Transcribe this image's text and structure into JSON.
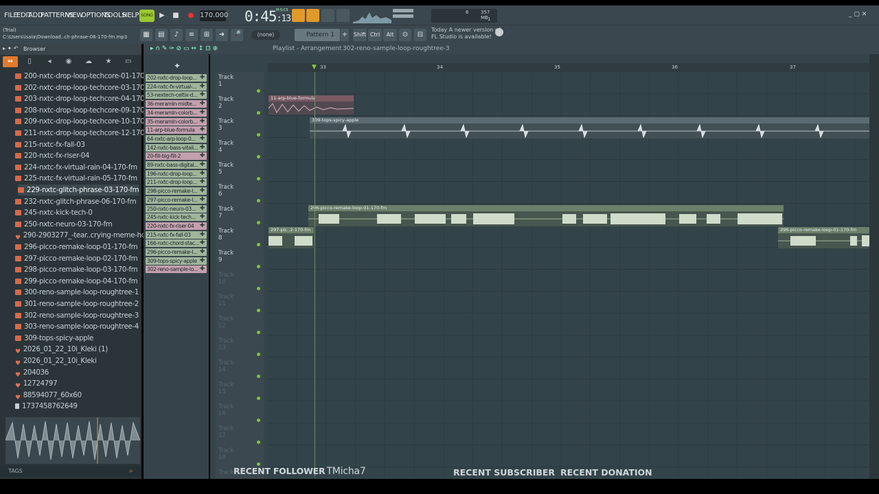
{
  "menu": [
    "FILE",
    "EDIT",
    "ADD",
    "PATTERNS",
    "VIEW",
    "OPTIONS",
    "TOOLS",
    "HELP"
  ],
  "transport": {
    "mode": "SONG",
    "tempo": "170.000",
    "time": "0:45",
    "time_frac": ":13",
    "time_unit": "M:S:CS",
    "cpu": "6",
    "mem": "357 MB",
    "poly": "1"
  },
  "title": {
    "trial": "(Trial)",
    "path": "C:\\Users\\isaia\\Download..ch-phrase-06-170-fm.mp3"
  },
  "toolbar2": {
    "none_label": "(none)",
    "pattern": "Pattern 1",
    "shift": "Shift",
    "ctrl": "Ctrl",
    "alt": "Alt"
  },
  "hint": {
    "line1": "Today  A newer version of",
    "line2": "FL Studio is available!"
  },
  "browser": {
    "title": "Browser",
    "tags": "TAGS",
    "items": [
      {
        "label": "200-nxtc-drop-loop-techcore-01-170-fm",
        "type": "audio"
      },
      {
        "label": "202-nxtc-drop-loop-techcore-03-170-fm",
        "type": "audio"
      },
      {
        "label": "203-nxtc-drop-loop-techcore-04-170-fm",
        "type": "audio"
      },
      {
        "label": "208-nxtc-drop-loop-techcore-09-170-fm",
        "type": "audio"
      },
      {
        "label": "209-nxtc-drop-loop-techcore-10-170-fm",
        "type": "audio"
      },
      {
        "label": "211-nxtc-drop-loop-techcore-12-170-fm",
        "type": "audio"
      },
      {
        "label": "215-nxtc-fx-fall-03",
        "type": "audio"
      },
      {
        "label": "220-nxtc-fx-riser-04",
        "type": "audio"
      },
      {
        "label": "224-nxtc-fx-virtual-rain-04-170-fm",
        "type": "audio"
      },
      {
        "label": "225-nxtc-fx-virtual-rain-05-170-fm",
        "type": "audio"
      },
      {
        "label": "229-nxtc-glitch-phrase-03-170-fm",
        "type": "audio"
      },
      {
        "label": "232-nxtc-glitch-phrase-06-170-fm",
        "type": "audio"
      },
      {
        "label": "245-nxtc-kick-tech-0",
        "type": "audio"
      },
      {
        "label": "250-nxtc-neuro-03-170-fm",
        "type": "audio"
      },
      {
        "label": "290-2903277_-tear..crying-meme-hd-png",
        "type": "image"
      },
      {
        "label": "296-picco-remake-loop-01-170-fm",
        "type": "audio"
      },
      {
        "label": "297-picco-remake-loop-02-170-fm",
        "type": "audio"
      },
      {
        "label": "298-picco-remake-loop-03-170-fm",
        "type": "audio"
      },
      {
        "label": "299-picco-remake-loop-04-170-fm",
        "type": "audio"
      },
      {
        "label": "300-reno-sample-loop-roughtree-1",
        "type": "audio"
      },
      {
        "label": "301-reno-sample-loop-roughtree-2",
        "type": "audio"
      },
      {
        "label": "302-reno-sample-loop-roughtree-3",
        "type": "audio"
      },
      {
        "label": "303-reno-sample-loop-roughtree-4",
        "type": "audio"
      },
      {
        "label": "309-tops-spicy-apple",
        "type": "audio"
      },
      {
        "label": "2026_01_22_10i_Kleki (1)",
        "type": "image"
      },
      {
        "label": "2026_01_22_10i_Kleki",
        "type": "image"
      },
      {
        "label": "204036",
        "type": "image"
      },
      {
        "label": "12724797",
        "type": "image"
      },
      {
        "label": "88594077_60x60",
        "type": "image"
      },
      {
        "label": "1737458762649",
        "type": "file"
      }
    ]
  },
  "picker": [
    {
      "label": "202-nxtc-drop-loop...",
      "color": "green"
    },
    {
      "label": "224-nxtc-fx-virtual-...",
      "color": "green"
    },
    {
      "label": "53-nextech-celtix-d...",
      "color": "green"
    },
    {
      "label": "36-meramIn-midte...",
      "color": "pink"
    },
    {
      "label": "34-meramIn-colorb...",
      "color": "pink"
    },
    {
      "label": "35-meramIn-colorb...",
      "color": "pink"
    },
    {
      "label": "11-arp-blue-formula",
      "color": "pink"
    },
    {
      "label": "64-nxtc-arp-loop-0...",
      "color": "green"
    },
    {
      "label": "142-nxtc-bass-vitali...",
      "color": "green"
    },
    {
      "label": "20-fill-big-fill-2",
      "color": "pink"
    },
    {
      "label": "89-nxtc-bass-digital...",
      "color": "green"
    },
    {
      "label": "196-nxtc-drop-loop...",
      "color": "green"
    },
    {
      "label": "211-nxtc-drop-loop...",
      "color": "green"
    },
    {
      "label": "298-picco-remake-l...",
      "color": "green"
    },
    {
      "label": "297-picco-remake-l...",
      "color": "green"
    },
    {
      "label": "250-nxtc-neuro-03...",
      "color": "green"
    },
    {
      "label": "245-nxtc-kick-tech...",
      "color": "green"
    },
    {
      "label": "220-nxtc-fx-riser-04",
      "color": "pink"
    },
    {
      "label": "215-nxtc-fx-fall-03",
      "color": "green"
    },
    {
      "label": "166-nxtc-chord-stac...",
      "color": "green"
    },
    {
      "label": "296-picco-remake-l...",
      "color": "green"
    },
    {
      "label": "309-tops-spicy-apple",
      "color": "green"
    },
    {
      "label": "302-reno-sample-lo...",
      "color": "pink"
    }
  ],
  "playlist": {
    "title": "Playlist - Arrangement",
    "crumb": "302-reno-sample-loop-roughtree-3",
    "bars": [
      "33",
      "34",
      "35",
      "36",
      "37"
    ],
    "tracks": [
      "Track 1",
      "Track 2",
      "Track 3",
      "Track 4",
      "Track 5",
      "Track 6",
      "Track 7",
      "Track 8",
      "Track 9",
      "Track 10",
      "Track 11",
      "Track 12",
      "Track 13",
      "Track 14",
      "Track 15",
      "Track 16",
      "Track 17",
      "Track 18",
      "Track"
    ],
    "clips": {
      "c1": "11-arp-blue-formula",
      "c2": "309-tops-spicy-apple",
      "c3": "296-picco-remake-loop-01-170-fm",
      "c4": "297-pic..2-170-fm",
      "c5": "296-picco-remake-loop-01-170-fm"
    }
  },
  "overlay": {
    "follower": "RECENT FOLLOWER",
    "follower_name": "TMicha7",
    "subscriber": "RECENT SUBSCRIBER",
    "donation": "RECENT DONATION"
  }
}
